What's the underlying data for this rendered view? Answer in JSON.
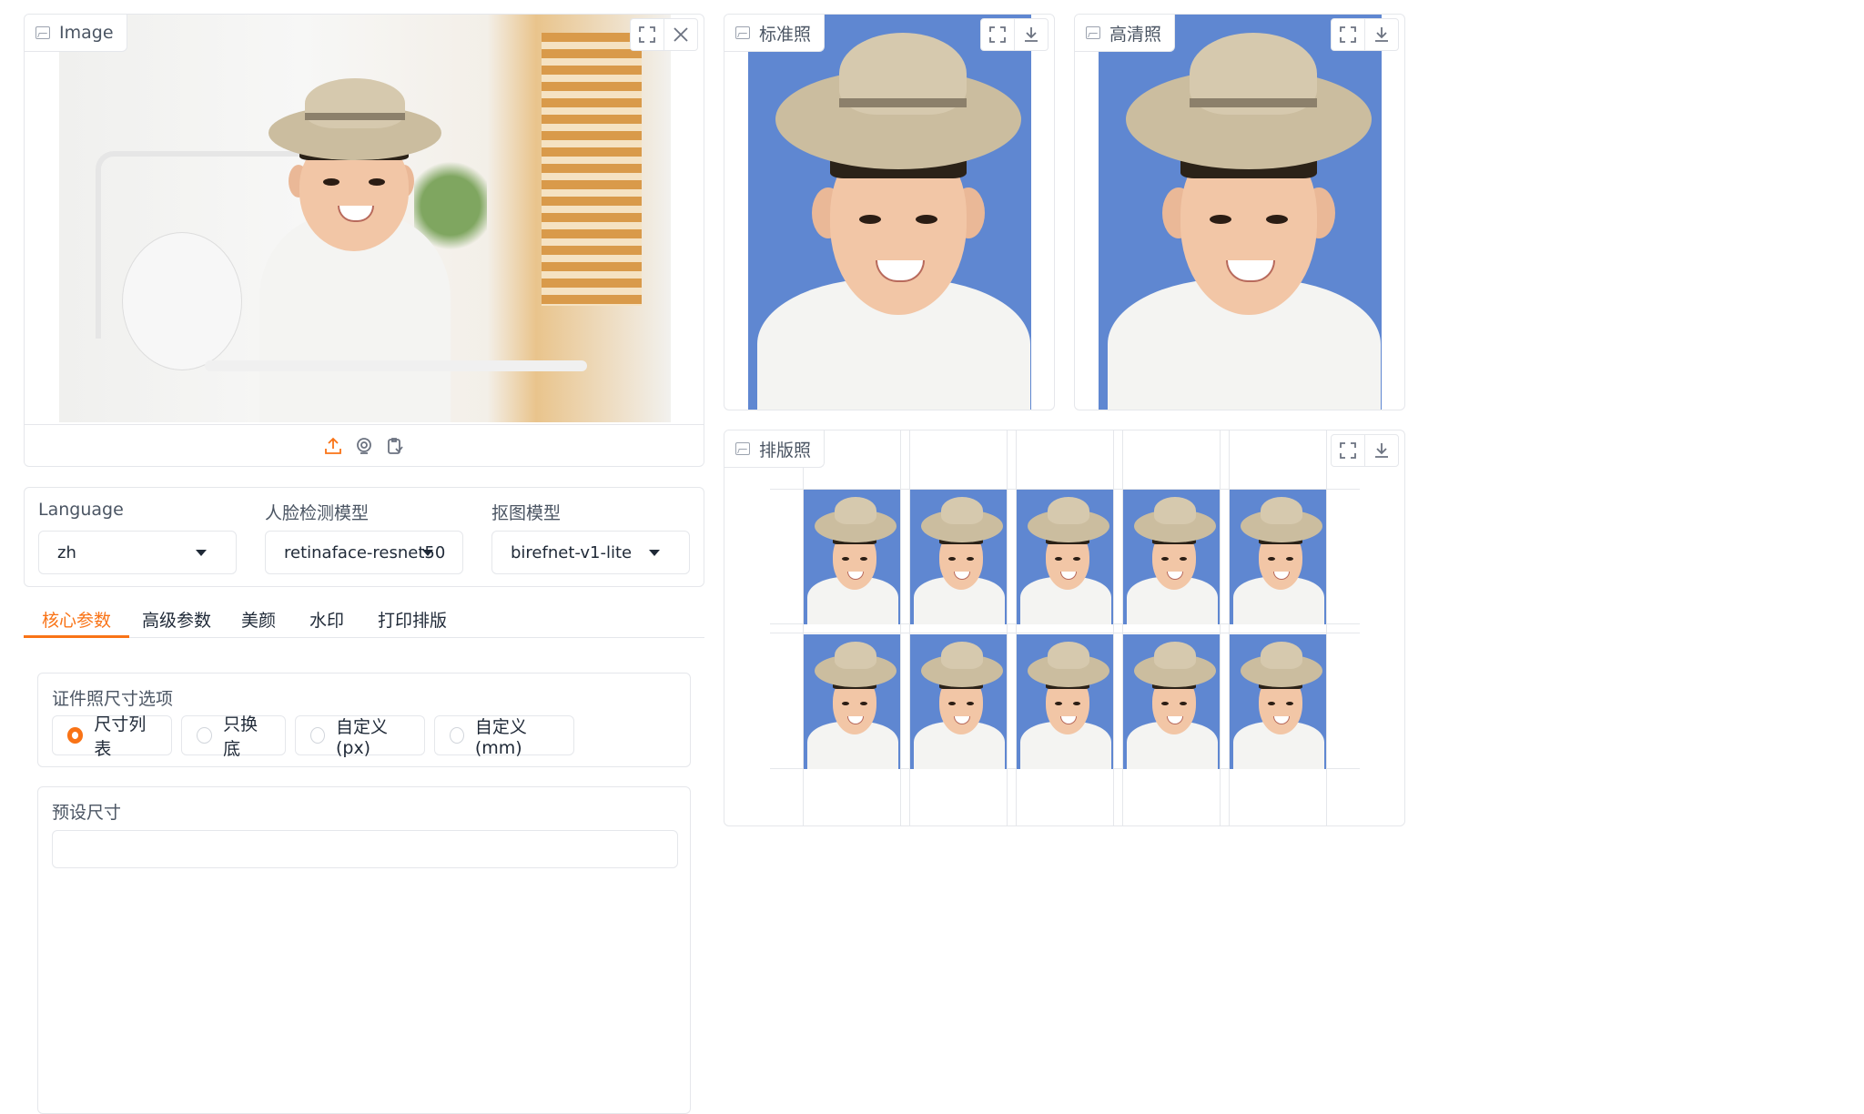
{
  "input_image": {
    "label": "Image"
  },
  "outputs": {
    "standard": {
      "label": "标准照"
    },
    "hd": {
      "label": "高清照"
    },
    "layout": {
      "label": "排版照"
    }
  },
  "settings": {
    "language": {
      "label": "Language",
      "value": "zh"
    },
    "face_model": {
      "label": "人脸检测模型",
      "value": "retinaface-resnet50"
    },
    "matting_model": {
      "label": "抠图模型",
      "value": "birefnet-v1-lite"
    }
  },
  "tabs": [
    {
      "label": "核心参数",
      "active": true
    },
    {
      "label": "高级参数",
      "active": false
    },
    {
      "label": "美颜",
      "active": false
    },
    {
      "label": "水印",
      "active": false
    },
    {
      "label": "打印排版",
      "active": false
    }
  ],
  "size_options": {
    "title": "证件照尺寸选项",
    "options": [
      {
        "label": "尺寸列表",
        "checked": true
      },
      {
        "label": "只换底",
        "checked": false
      },
      {
        "label": "自定义(px)",
        "checked": false
      },
      {
        "label": "自定义(mm)",
        "checked": false
      }
    ]
  },
  "preset": {
    "title": "预设尺寸"
  },
  "colors": {
    "accent": "#f97316",
    "id_background": "#5f87d1"
  },
  "icons": [
    "image-icon",
    "fullscreen-icon",
    "close-icon",
    "download-icon",
    "upload-icon",
    "webcam-icon",
    "clipboard-icon",
    "chevron-down-icon"
  ]
}
